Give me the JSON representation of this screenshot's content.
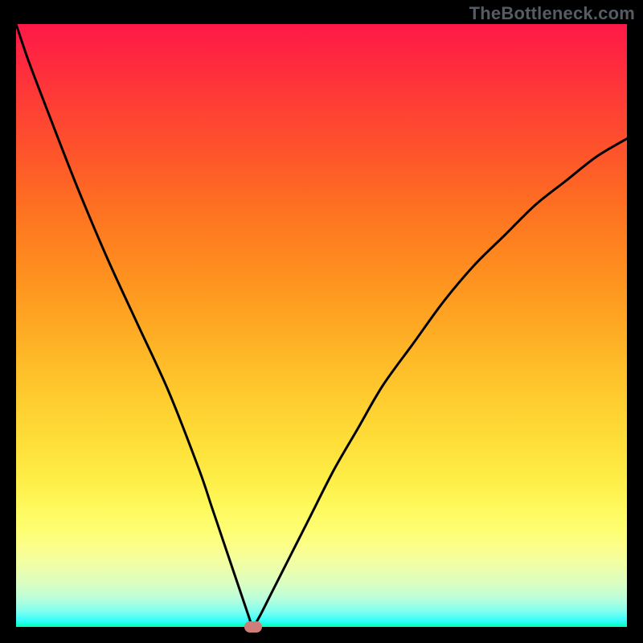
{
  "watermark": "TheBottleneck.com",
  "chart_data": {
    "type": "line",
    "title": "",
    "xlabel": "",
    "ylabel": "",
    "xlim": [
      0,
      100
    ],
    "ylim": [
      0,
      100
    ],
    "grid": false,
    "legend": false,
    "x": [
      0,
      2,
      5,
      10,
      15,
      20,
      25,
      30,
      32,
      34,
      35,
      36,
      37,
      38,
      38.5,
      38.8,
      40,
      42,
      45,
      48,
      52,
      56,
      60,
      65,
      70,
      75,
      80,
      85,
      90,
      95,
      100
    ],
    "y": [
      100,
      94,
      86,
      73,
      61,
      50,
      39,
      26,
      20,
      14,
      11,
      8,
      5,
      2,
      0.5,
      0,
      2,
      6,
      12,
      18,
      26,
      33,
      40,
      47,
      54,
      60,
      65,
      70,
      74,
      78,
      81
    ],
    "marker": {
      "x": 38.8,
      "y": 0,
      "color": "#cf7d78"
    },
    "gradient_stops": [
      {
        "pos": 0.0,
        "color": "#fe1948"
      },
      {
        "pos": 0.06,
        "color": "#fe293f"
      },
      {
        "pos": 0.14,
        "color": "#fe4034"
      },
      {
        "pos": 0.22,
        "color": "#fe562a"
      },
      {
        "pos": 0.3,
        "color": "#fe6f22"
      },
      {
        "pos": 0.38,
        "color": "#fe861f"
      },
      {
        "pos": 0.46,
        "color": "#fe9d21"
      },
      {
        "pos": 0.54,
        "color": "#feb526"
      },
      {
        "pos": 0.62,
        "color": "#fecc2e"
      },
      {
        "pos": 0.7,
        "color": "#fee039"
      },
      {
        "pos": 0.76,
        "color": "#feef49"
      },
      {
        "pos": 0.8,
        "color": "#fef95c"
      },
      {
        "pos": 0.84,
        "color": "#fefe73"
      },
      {
        "pos": 0.87,
        "color": "#fbfe8d"
      },
      {
        "pos": 0.9,
        "color": "#eefea8"
      },
      {
        "pos": 0.93,
        "color": "#d8fec3"
      },
      {
        "pos": 0.955,
        "color": "#b5fedd"
      },
      {
        "pos": 0.975,
        "color": "#7dfef0"
      },
      {
        "pos": 0.99,
        "color": "#2ffefb"
      },
      {
        "pos": 1.0,
        "color": "#04fdb7"
      }
    ]
  }
}
